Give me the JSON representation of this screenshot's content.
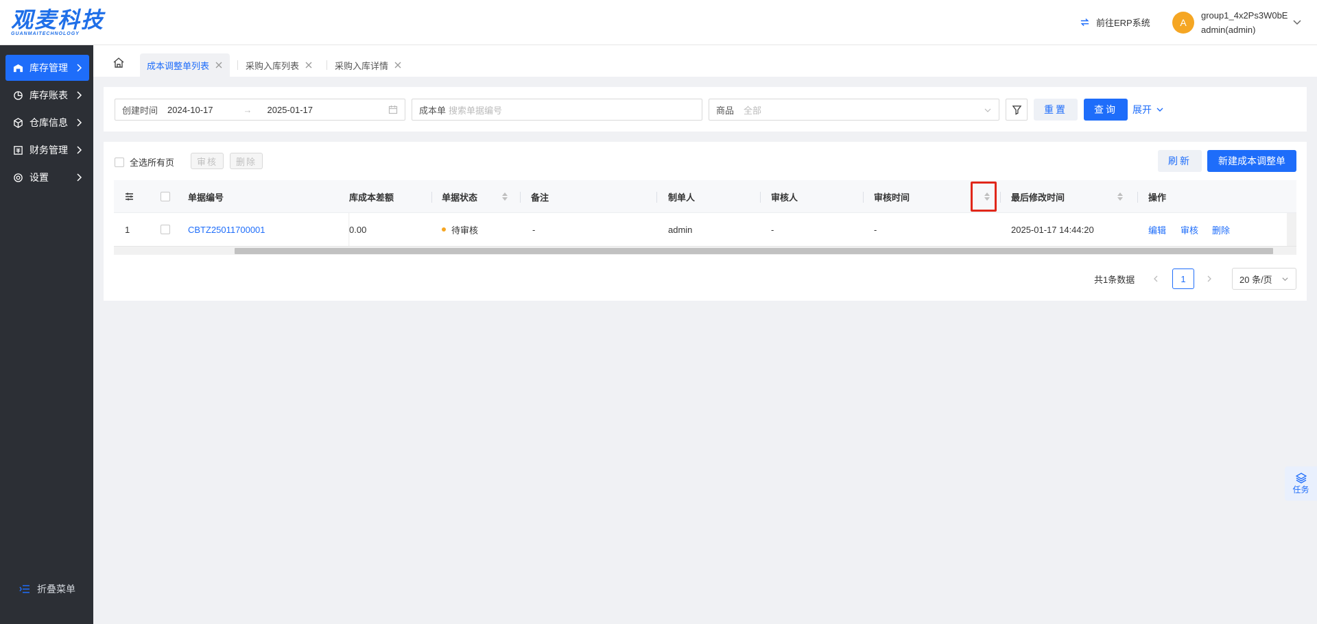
{
  "header": {
    "logo_text": "观麦科技",
    "logo_sub": "GUANMAITECHNOLOGY",
    "erp_link": "前往ERP系统",
    "avatar_letter": "A",
    "user_group": "group1_4x2Ps3W0bE",
    "user_name": "admin(admin)"
  },
  "sidebar": {
    "items": [
      {
        "label": "库存管理",
        "icon": "warehouse-icon",
        "active": true
      },
      {
        "label": "库存账表",
        "icon": "pie-chart-icon",
        "active": false
      },
      {
        "label": "仓库信息",
        "icon": "box-icon",
        "active": false
      },
      {
        "label": "财务管理",
        "icon": "finance-icon",
        "active": false
      },
      {
        "label": "设置",
        "icon": "gear-icon",
        "active": false
      }
    ],
    "collapse_label": "折叠菜单"
  },
  "tabs": [
    {
      "label": "成本调整单列表",
      "active": true
    },
    {
      "label": "采购入库列表",
      "active": false
    },
    {
      "label": "采购入库详情",
      "active": false
    }
  ],
  "filters": {
    "date_label": "创建时间",
    "date_start": "2024-10-17",
    "date_end": "2025-01-17",
    "order_label": "成本单",
    "order_placeholder": "搜索单据编号",
    "goods_label": "商品",
    "goods_value": "全部",
    "reset_label": "重置",
    "query_label": "查询",
    "expand_label": "展开"
  },
  "toolbar": {
    "select_all_label": "全选所有页",
    "audit_label": "审核",
    "delete_label": "删除",
    "refresh_label": "刷新",
    "new_label": "新建成本调整单"
  },
  "table": {
    "columns": {
      "order_no": "单据编号",
      "cost_diff": "库成本差额",
      "status": "单据状态",
      "remark": "备注",
      "creator": "制单人",
      "auditor": "审核人",
      "audit_time": "审核时间",
      "modified_time": "最后修改时间",
      "actions": "操作"
    },
    "rows": [
      {
        "index": "1",
        "order_no": "CBTZ25011700001",
        "cost_diff": "0.00",
        "status": "待审核",
        "remark": "-",
        "creator": "admin",
        "auditor": "-",
        "audit_time": "-",
        "modified_time": "2025-01-17 14:44:20",
        "action_edit": "编辑",
        "action_audit": "审核",
        "action_delete": "删除"
      }
    ]
  },
  "pagination": {
    "total_text": "共1条数据",
    "current_page": "1",
    "page_size": "20 条/页"
  },
  "float_task": {
    "label": "任务"
  },
  "colors": {
    "primary": "#1e6dfa",
    "sidebar_bg": "#2c2f35",
    "pending": "#f5a623",
    "highlight": "#e0271a"
  }
}
